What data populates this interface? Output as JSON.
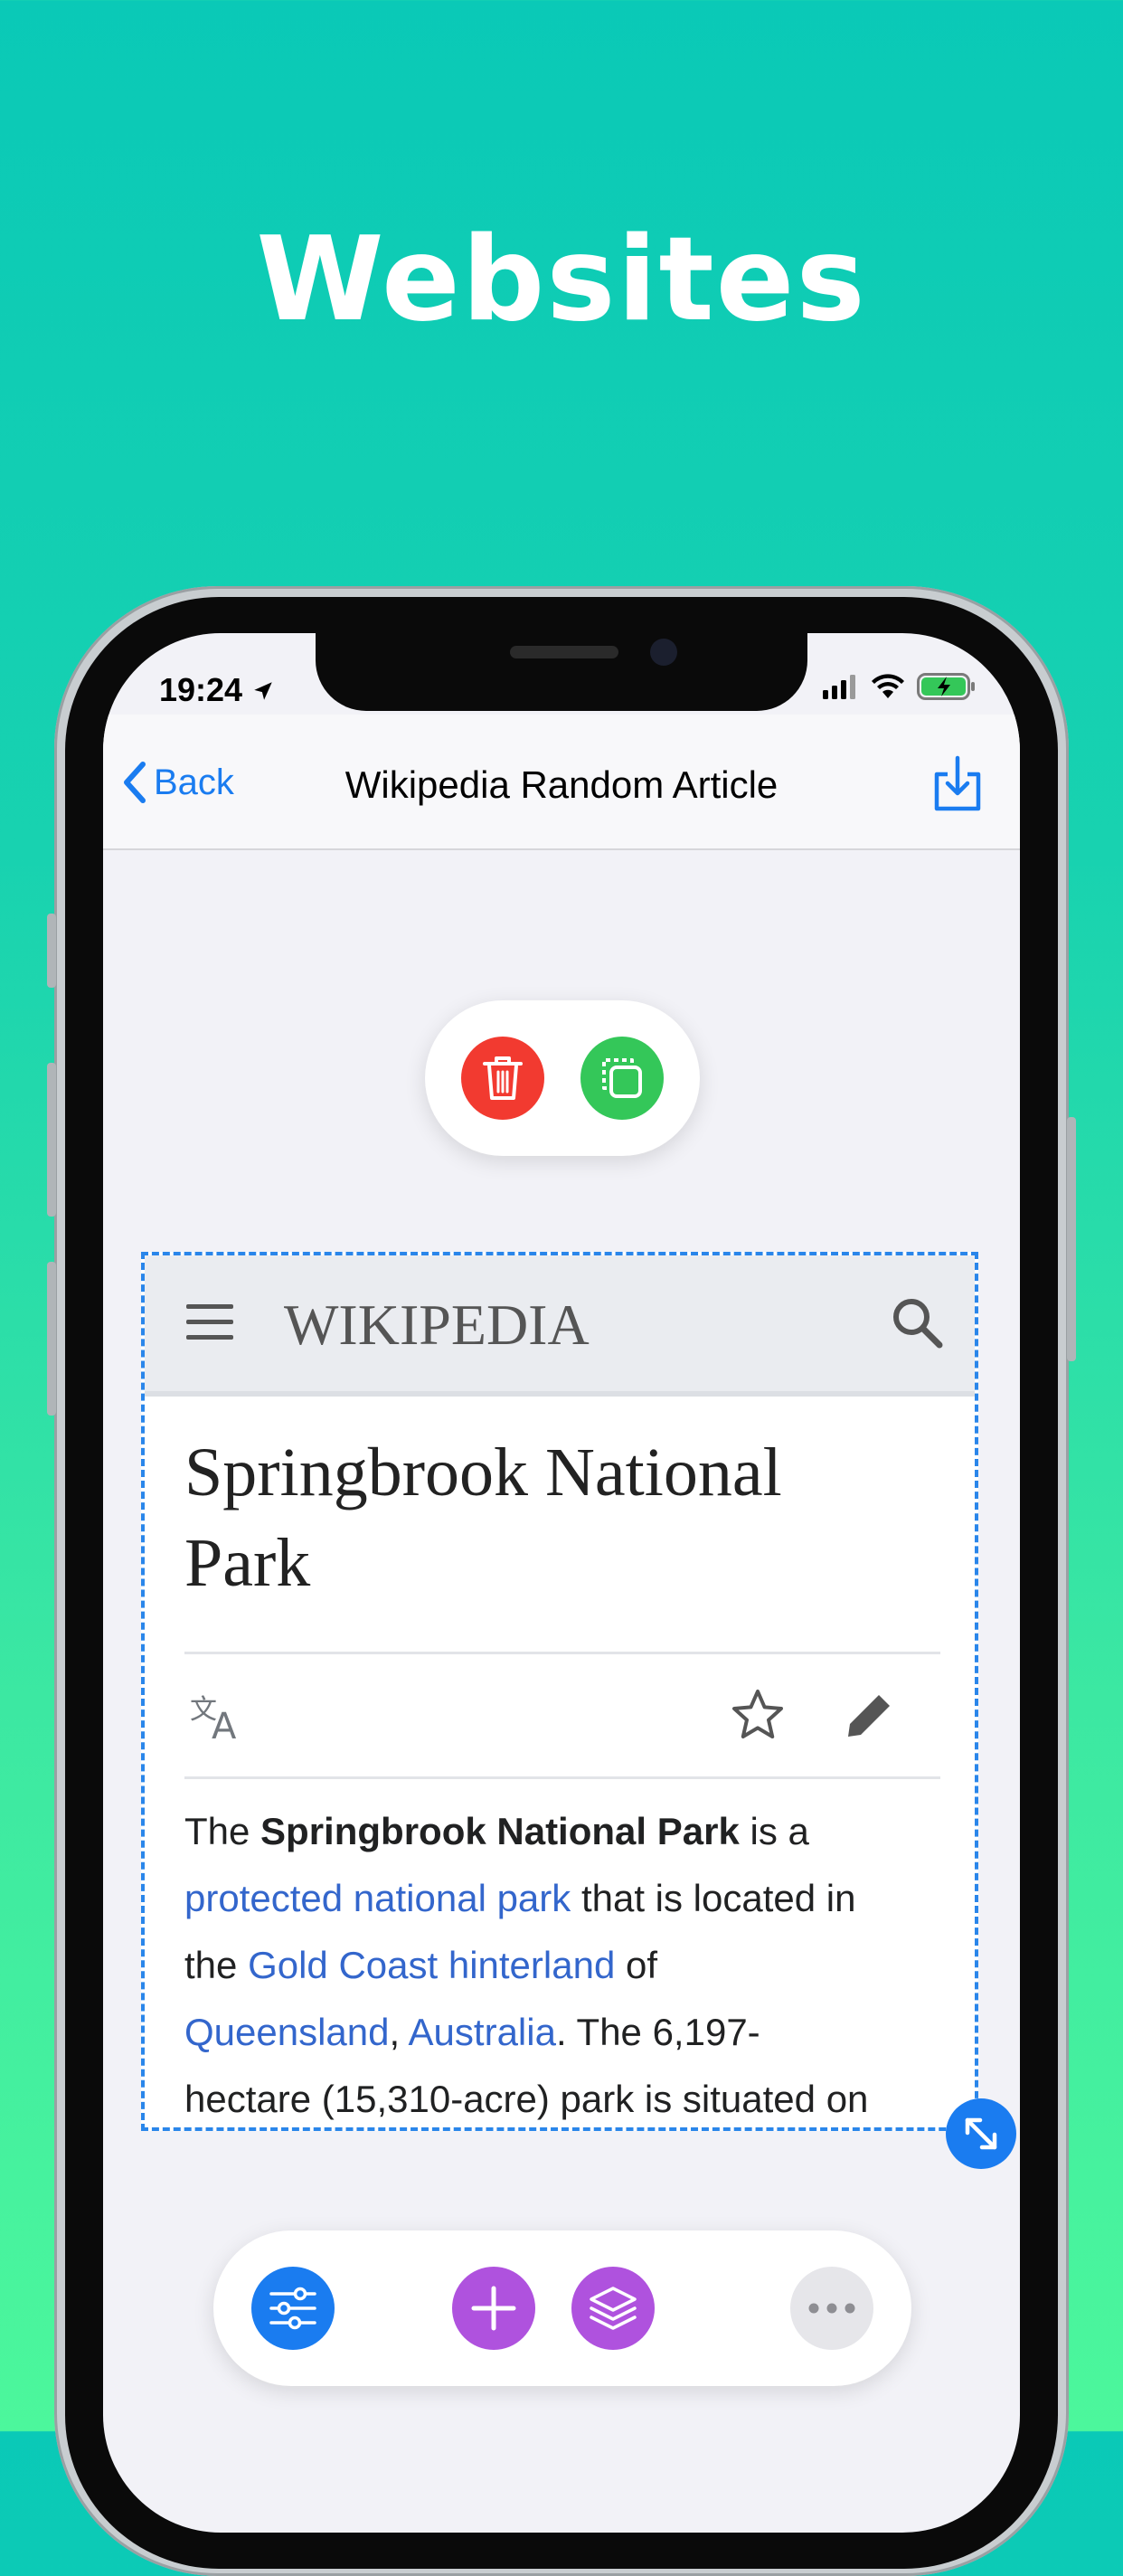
{
  "headline": "Websites",
  "status": {
    "time": "19:24"
  },
  "nav": {
    "back_label": "Back",
    "title": "Wikipedia Random Article"
  },
  "colors": {
    "accent": "#1a7cf0",
    "delete": "#f23a30",
    "copy": "#34c759",
    "purple": "#af52de",
    "more": "#e6e6ea"
  },
  "wiki": {
    "logo": "WIKIPEDIA",
    "title_line1": "Springbrook National",
    "title_line2": "Park",
    "body": {
      "t1": "The ",
      "b1": "Springbrook National Park",
      "t2": " is a",
      "l1": "protected national park",
      "t3": " that is located in",
      "t4": "the ",
      "l2": "Gold Coast hinterland",
      "t5": " of",
      "l3": "Queensland",
      "t6": ", ",
      "l4": "Australia",
      "t7": ". The 6,197-",
      "t8": "hectare (15,310-acre) park is situated on"
    }
  },
  "icons": {
    "location": "location-arrow-icon",
    "signal": "cellular-signal-icon",
    "wifi": "wifi-icon",
    "battery": "battery-charging-icon",
    "back": "chevron-left-icon",
    "download": "download-icon",
    "trash": "trash-icon",
    "copy": "duplicate-icon",
    "menu": "hamburger-menu-icon",
    "search": "search-icon",
    "translate": "translate-icon",
    "star": "star-icon",
    "edit": "pencil-icon",
    "resize": "resize-icon",
    "adjust": "sliders-icon",
    "add": "plus-icon",
    "layers": "layers-icon",
    "more": "ellipsis-icon"
  }
}
